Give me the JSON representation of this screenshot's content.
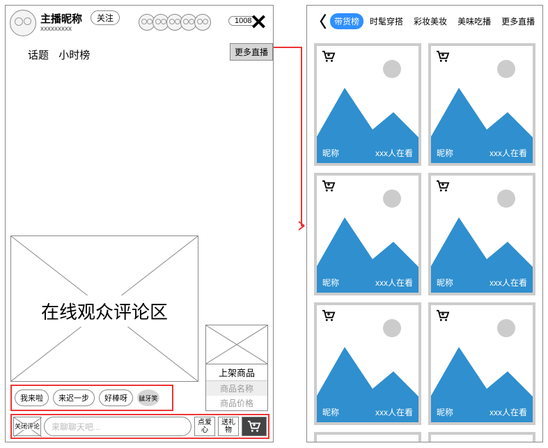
{
  "left": {
    "host_name": "主播昵称",
    "host_sub": "xxxxxxxxx",
    "follow": "关注",
    "count": "1008",
    "topic1": "话题",
    "topic2": "小时榜",
    "more_live": "更多直播",
    "comments_area": "在线观众评论区",
    "product_label": "上架商品",
    "product_name": "商品名称",
    "product_price": "商品价格",
    "chip1": "我来啦",
    "chip2": "来迟一步",
    "chip3": "好棒呀",
    "chip4": "龇牙笑",
    "close_comment": "关闭评论",
    "chat_placeholder": "来聊聊天吧...",
    "heart_btn": "点爱心",
    "gift_btn": "送礼物"
  },
  "right": {
    "tabs": [
      "带货榜",
      "时髦穿搭",
      "彩妆美妆",
      "美味吃播",
      "更多直播"
    ],
    "nickname": "昵称",
    "watching": "xxx人在看"
  }
}
